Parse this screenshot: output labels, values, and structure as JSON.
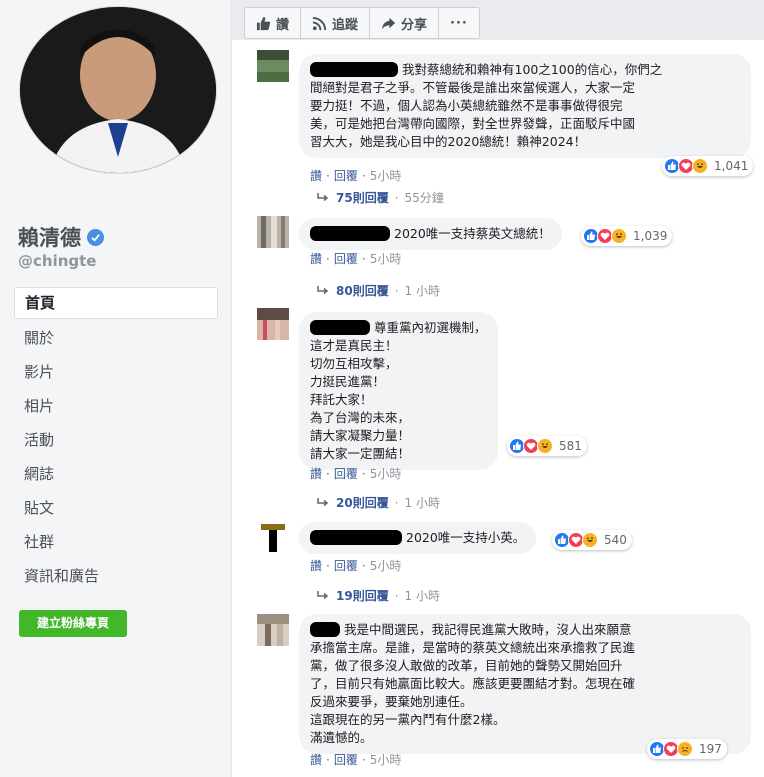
{
  "page": {
    "name": "賴清德",
    "handle": "@chingte",
    "nav": [
      "首頁",
      "關於",
      "影片",
      "相片",
      "活動",
      "網誌",
      "貼文",
      "社群",
      "資訊和廣告"
    ],
    "create_button": "建立粉絲專頁"
  },
  "actionbar": {
    "like": "讚",
    "follow": "追蹤",
    "share": "分享",
    "more": "···"
  },
  "comments": [
    {
      "text": "我對蔡總統和賴神有100之100的信心，你們之\n間絕對是君子之爭。不管最後是誰出來當候選人，大家一定\n要力挺！不過，個人認為小英總統雖然不是事事做得很完\n美，可是她把台灣帶向國際，對全世界發聲，正面駁斥中國\n習大大，她是我心目中的2020總統！賴神2024！",
      "reaction_count": "1,041",
      "like": "讚",
      "reply": "回覆",
      "time": "5小時",
      "replies_label": "75則回覆",
      "replies_time": "55分鐘"
    },
    {
      "text": "2020唯一支持蔡英文總統！",
      "reaction_count": "1,039",
      "like": "讚",
      "reply": "回覆",
      "time": "5小時",
      "replies_label": "80則回覆",
      "replies_time": "1 小時"
    },
    {
      "text": "尊重黨內初選機制，\n這才是真民主！\n切勿互相攻擊，\n力挺民進黨！\n拜託大家！\n為了台灣的未來，\n請大家凝聚力量！\n請大家一定團結！",
      "reaction_count": "581",
      "like": "讚",
      "reply": "回覆",
      "time": "5小時",
      "replies_label": "20則回覆",
      "replies_time": "1 小時"
    },
    {
      "text": "2020唯一支持小英。",
      "reaction_count": "540",
      "like": "讚",
      "reply": "回覆",
      "time": "5小時",
      "replies_label": "19則回覆",
      "replies_time": "1 小時"
    },
    {
      "text": "我是中間選民，我記得民進黨大敗時，沒人出來願意\n承擔當主席。是誰，是當時的蔡英文總統出來承擔救了民進\n黨，做了很多沒人敢做的改革，目前她的聲勢又開始回升\n了，目前只有她贏面比較大。應該更要團結才對。怎現在確\n反過來要爭，要棄她別連任。\n這跟現在的另一黨內鬥有什麼2樣。\n滿遺憾的。",
      "reaction_count": "197",
      "like": "讚",
      "reply": "回覆",
      "time": "5小時"
    }
  ],
  "colors": {
    "link": "#385898",
    "green_button": "#42b72a",
    "like_blue": "#2078f4",
    "love_red": "#f33e58",
    "haha_yellow": "#f7b125"
  }
}
